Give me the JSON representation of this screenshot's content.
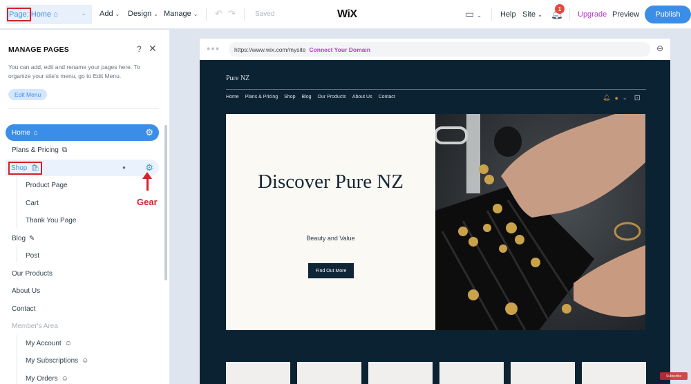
{
  "topbar": {
    "page_prefix": "Page:",
    "page_name": "Home",
    "menus": [
      "Add",
      "Design",
      "Manage"
    ],
    "saved_label": "Saved",
    "logo": "WiX",
    "help_label": "Help",
    "site_label": "Site",
    "notification_count": "1",
    "upgrade_label": "Upgrade",
    "preview_label": "Preview",
    "publish_label": "Publish"
  },
  "panel": {
    "title": "MANAGE PAGES",
    "help_glyph": "?",
    "close_glyph": "✕",
    "description": "You can add, edit and rename your pages here. To organize your site's menu, go to Edit Menu.",
    "edit_menu_label": "Edit Menu",
    "pages": [
      {
        "label": "Home",
        "state": "active",
        "icon": "home-icon"
      },
      {
        "label": "Plans & Pricing",
        "state": "normal",
        "icon": "pricing-icon"
      },
      {
        "label": "Shop",
        "state": "hover",
        "icon": "shopping-bag-icon"
      },
      {
        "label": "Product Page",
        "state": "sub"
      },
      {
        "label": "Cart",
        "state": "sub"
      },
      {
        "label": "Thank You Page",
        "state": "sub"
      },
      {
        "label": "Blog",
        "state": "normal",
        "icon": "pen-icon"
      },
      {
        "label": "Post",
        "state": "sub"
      },
      {
        "label": "Our Products",
        "state": "normal"
      },
      {
        "label": "About Us",
        "state": "normal"
      },
      {
        "label": "Contact",
        "state": "normal"
      },
      {
        "label": "Member's Area",
        "state": "muted"
      },
      {
        "label": "My Account",
        "state": "sub",
        "icon": "member-icon"
      },
      {
        "label": "My Subscriptions",
        "state": "sub",
        "icon": "member-icon"
      },
      {
        "label": "My Orders",
        "state": "sub",
        "icon": "member-icon"
      }
    ],
    "annotation_label": "Gear"
  },
  "browser": {
    "url": "https://www.wix.com/mysite",
    "connect_label": "Connect Your Domain"
  },
  "site": {
    "name": "Pure NZ",
    "nav": [
      "Home",
      "Plans & Pricing",
      "Shop",
      "Blog",
      "Our Products",
      "About Us",
      "Contact"
    ],
    "hero_title": "Discover Pure NZ",
    "hero_subtitle": "Beauty and Value",
    "hero_button": "Find Out More",
    "subscribe_label": "Subscribe"
  },
  "colors": {
    "accent": "#3b8ee8",
    "upgrade": "#b13bc6",
    "annotation": "#d6202a",
    "site_bg": "#0b2233",
    "hero_bg": "#fbf9f4"
  }
}
